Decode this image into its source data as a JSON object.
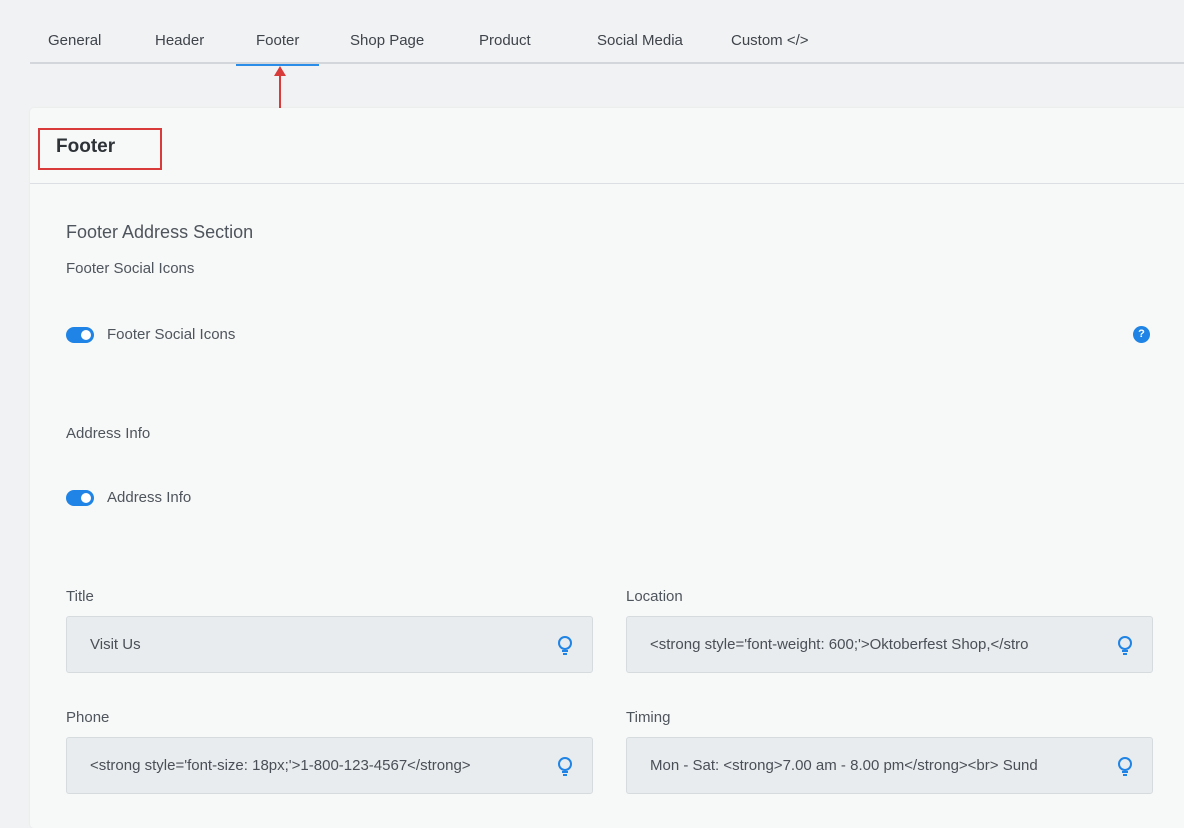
{
  "tabs": [
    {
      "label": "General"
    },
    {
      "label": "Header"
    },
    {
      "label": "Footer",
      "active": true
    },
    {
      "label": "Shop Page"
    },
    {
      "label": "Product"
    },
    {
      "label": "Social Media"
    },
    {
      "label": "Custom </>"
    }
  ],
  "panel": {
    "title": "Footer",
    "section_title": "Footer Address Section",
    "social_icons": {
      "group_label": "Footer Social Icons",
      "toggle_label": "Footer Social Icons",
      "enabled": true,
      "help": "?"
    },
    "address_info": {
      "group_label": "Address Info",
      "toggle_label": "Address Info",
      "enabled": true
    },
    "fields": {
      "title": {
        "label": "Title",
        "value": "Visit Us"
      },
      "location": {
        "label": "Location",
        "value": "<strong style='font-weight: 600;'>Oktoberfest Shop,</stro"
      },
      "phone": {
        "label": "Phone",
        "value": "<strong style='font-size: 18px;'>1-800-123-4567</strong>"
      },
      "timing": {
        "label": "Timing",
        "value": "Mon - Sat: <strong>7.00 am - 8.00 pm</strong><br> Sund"
      }
    }
  },
  "colors": {
    "accent": "#1f84e5",
    "annotation": "#d93a3a",
    "field_bg": "#e8ecee"
  }
}
